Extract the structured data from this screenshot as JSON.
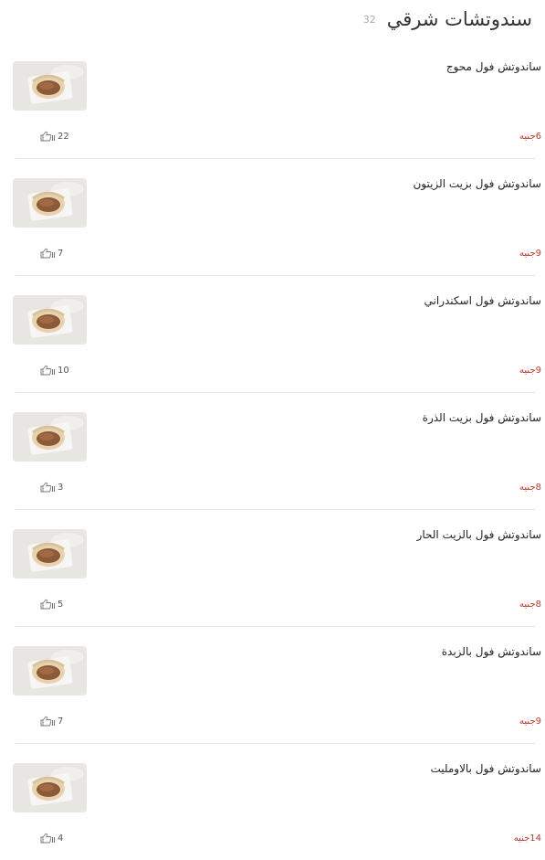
{
  "header": {
    "title": "سندوتشات شرقي",
    "count": "32"
  },
  "items": [
    {
      "name": "ساندوتش فول محوج",
      "price": "6جنيه",
      "likes": "22"
    },
    {
      "name": "ساندوتش فول بزيت الزيتون",
      "price": "9جنيه",
      "likes": "7"
    },
    {
      "name": "ساندوتش فول اسكندراني",
      "price": "9جنيه",
      "likes": "10"
    },
    {
      "name": "ساندوتش فول بزيت الذرة",
      "price": "8جنيه",
      "likes": "3"
    },
    {
      "name": "ساندوتش فول بالزيت الحار",
      "price": "8جنيه",
      "likes": "5"
    },
    {
      "name": "ساندوتش فول بالزبدة",
      "price": "9جنيه",
      "likes": "7"
    },
    {
      "name": "ساندوتش فول بالاومليت",
      "price": "14جنيه",
      "likes": "4"
    }
  ],
  "colors": {
    "price": "#c0392b",
    "divider": "#e4e4e4",
    "count": "#aaaaaa"
  },
  "icons": {
    "like": "thumbs-up-icon"
  }
}
